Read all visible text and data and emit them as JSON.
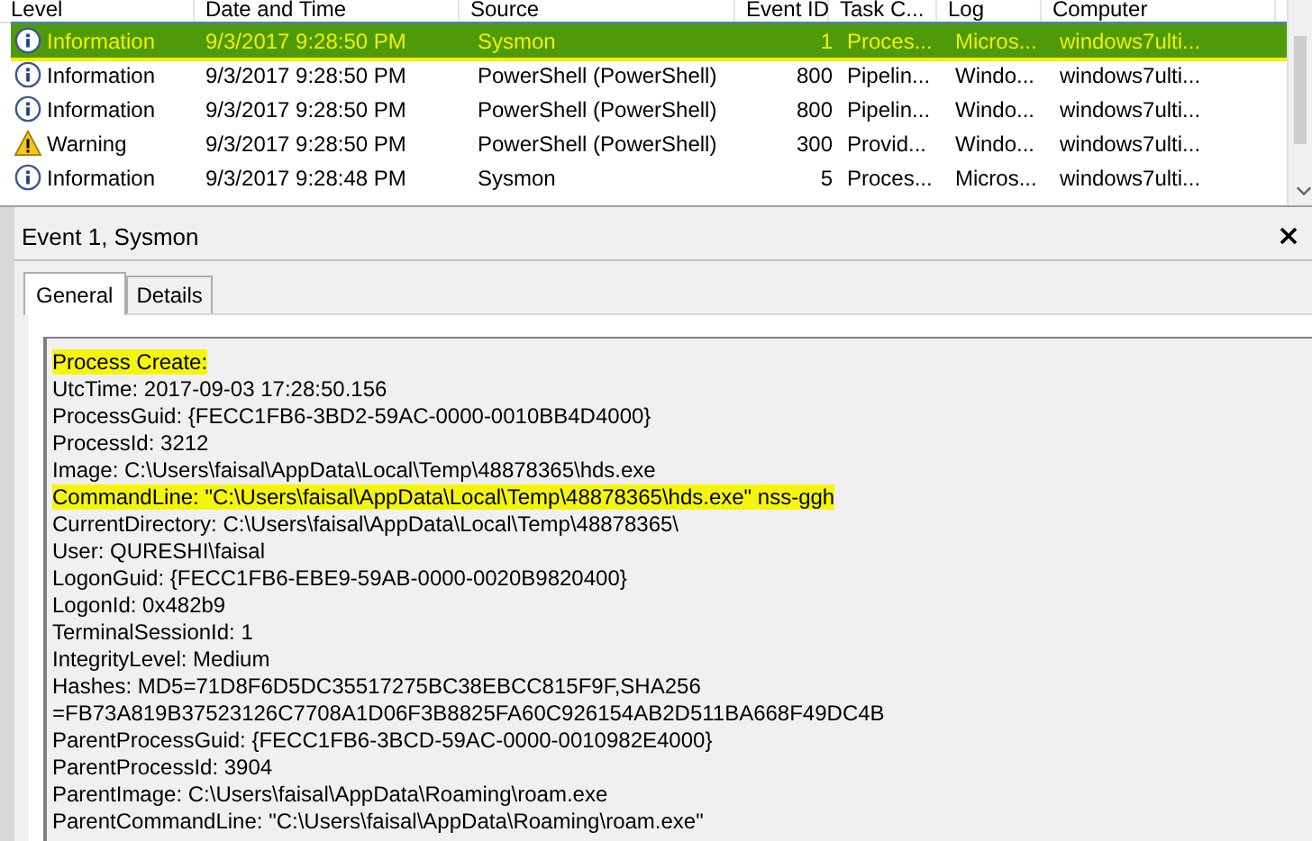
{
  "events": {
    "columns": [
      "Level",
      "Date and Time",
      "Source",
      "Event ID",
      "Task C...",
      "Log",
      "Computer"
    ],
    "rows": [
      {
        "kind": "information",
        "selected": true,
        "highlighted": true,
        "cells": [
          "Information",
          "9/3/2017 9:28:50 PM",
          "Sysmon",
          "1",
          "Proces...",
          "Micros...",
          "windows7ulti..."
        ]
      },
      {
        "kind": "information",
        "selected": false,
        "highlighted": false,
        "cells": [
          "Information",
          "9/3/2017 9:28:50 PM",
          "PowerShell (PowerShell)",
          "800",
          "Pipelin...",
          "Windo...",
          "windows7ulti..."
        ]
      },
      {
        "kind": "information",
        "selected": false,
        "highlighted": false,
        "cells": [
          "Information",
          "9/3/2017 9:28:50 PM",
          "PowerShell (PowerShell)",
          "800",
          "Pipelin...",
          "Windo...",
          "windows7ulti..."
        ]
      },
      {
        "kind": "warning",
        "selected": false,
        "highlighted": false,
        "cells": [
          "Warning",
          "9/3/2017 9:28:50 PM",
          "PowerShell (PowerShell)",
          "300",
          "Provid...",
          "Windo...",
          "windows7ulti..."
        ]
      },
      {
        "kind": "information",
        "selected": false,
        "highlighted": false,
        "cells": [
          "Information",
          "9/3/2017 9:28:48 PM",
          "Sysmon",
          "5",
          "Proces...",
          "Micros...",
          "windows7ulti..."
        ]
      }
    ]
  },
  "detail": {
    "title": "Event 1, Sysmon",
    "tabs": [
      {
        "label": "General",
        "selected": true
      },
      {
        "label": "Details",
        "selected": false
      }
    ],
    "lines": [
      {
        "text": "Process Create:",
        "highlighted": true
      },
      {
        "text": "UtcTime: 2017-09-03 17:28:50.156",
        "highlighted": false
      },
      {
        "text": "ProcessGuid: {FECC1FB6-3BD2-59AC-0000-0010BB4D4000}",
        "highlighted": false
      },
      {
        "text": "ProcessId: 3212",
        "highlighted": false
      },
      {
        "text": "Image: C:\\Users\\faisal\\AppData\\Local\\Temp\\48878365\\hds.exe",
        "highlighted": false
      },
      {
        "text": "CommandLine: \"C:\\Users\\faisal\\AppData\\Local\\Temp\\48878365\\hds.exe\" nss-ggh",
        "highlighted": true
      },
      {
        "text": "CurrentDirectory: C:\\Users\\faisal\\AppData\\Local\\Temp\\48878365\\",
        "highlighted": false
      },
      {
        "text": "User: QURESHI\\faisal",
        "highlighted": false
      },
      {
        "text": "LogonGuid: {FECC1FB6-EBE9-59AB-0000-0020B9820400}",
        "highlighted": false
      },
      {
        "text": "LogonId: 0x482b9",
        "highlighted": false
      },
      {
        "text": "TerminalSessionId: 1",
        "highlighted": false
      },
      {
        "text": "IntegrityLevel: Medium",
        "highlighted": false
      },
      {
        "text": "Hashes: MD5=71D8F6D5DC35517275BC38EBCC815F9F,SHA256",
        "highlighted": false
      },
      {
        "text": "=FB73A819B37523126C7708A1D06F3B8825FA60C926154AB2D511BA668F49DC4B",
        "highlighted": false
      },
      {
        "text": "ParentProcessGuid: {FECC1FB6-3BCD-59AC-0000-0010982E4000}",
        "highlighted": false
      },
      {
        "text": "ParentProcessId: 3904",
        "highlighted": false
      },
      {
        "text": "ParentImage: C:\\Users\\faisal\\AppData\\Roaming\\roam.exe",
        "highlighted": false
      },
      {
        "text": "ParentCommandLine: \"C:\\Users\\faisal\\AppData\\Roaming\\roam.exe\"",
        "highlighted": false
      }
    ]
  }
}
